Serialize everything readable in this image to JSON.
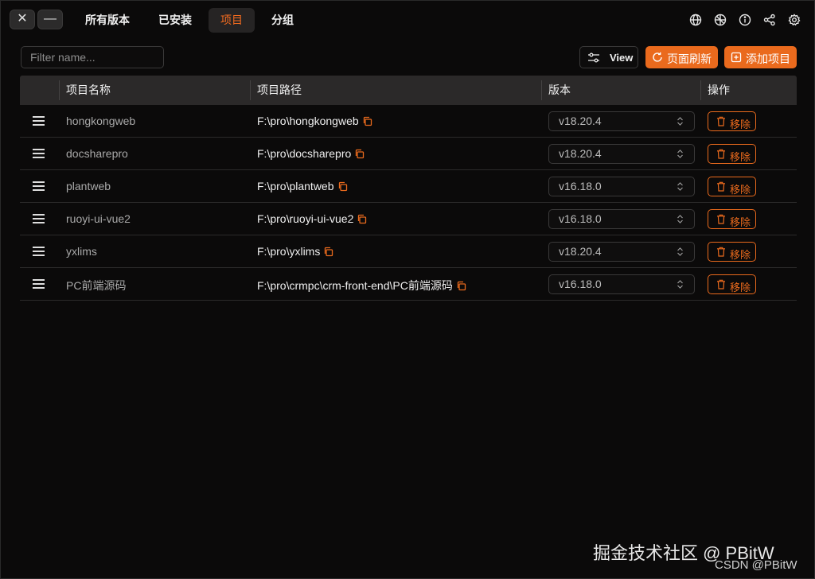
{
  "window": {
    "close_glyph": "✕",
    "minimize_glyph": "—"
  },
  "nav": {
    "tabs": [
      {
        "label": "所有版本",
        "active": false
      },
      {
        "label": "已安装",
        "active": false
      },
      {
        "label": "项目",
        "active": true
      },
      {
        "label": "分组",
        "active": false
      }
    ],
    "icons": [
      "globe-icon",
      "aperture-icon",
      "info-icon",
      "share-icon",
      "settings-icon"
    ]
  },
  "toolbar": {
    "filter_placeholder": "Filter name...",
    "view_label": "View",
    "refresh_label": "页面刷新",
    "add_label": "添加项目"
  },
  "table": {
    "headers": {
      "name": "项目名称",
      "path": "项目路径",
      "version": "版本",
      "action": "操作"
    },
    "rows": [
      {
        "name": "hongkongweb",
        "path": "F:\\pro\\hongkongweb",
        "version": "v18.20.4",
        "action": "移除"
      },
      {
        "name": "docsharepro",
        "path": "F:\\pro\\docsharepro",
        "version": "v18.20.4",
        "action": "移除"
      },
      {
        "name": "plantweb",
        "path": "F:\\pro\\plantweb",
        "version": "v16.18.0",
        "action": "移除"
      },
      {
        "name": "ruoyi-ui-vue2",
        "path": "F:\\pro\\ruoyi-ui-vue2",
        "version": "v16.18.0",
        "action": "移除"
      },
      {
        "name": "yxlims",
        "path": "F:\\pro\\yxlims",
        "version": "v18.20.4",
        "action": "移除"
      },
      {
        "name": "PC前端源码",
        "path": "F:\\pro\\crmpc\\crm-front-end\\PC前端源码",
        "version": "v16.18.0",
        "action": "移除"
      }
    ]
  },
  "watermark": {
    "line1": "掘金技术社区 @ PBitW",
    "line2": "CSDN @PBitW"
  },
  "colors": {
    "accent": "#ea6a1d",
    "background": "#0b0a0a",
    "header_bg": "#2b2929"
  }
}
